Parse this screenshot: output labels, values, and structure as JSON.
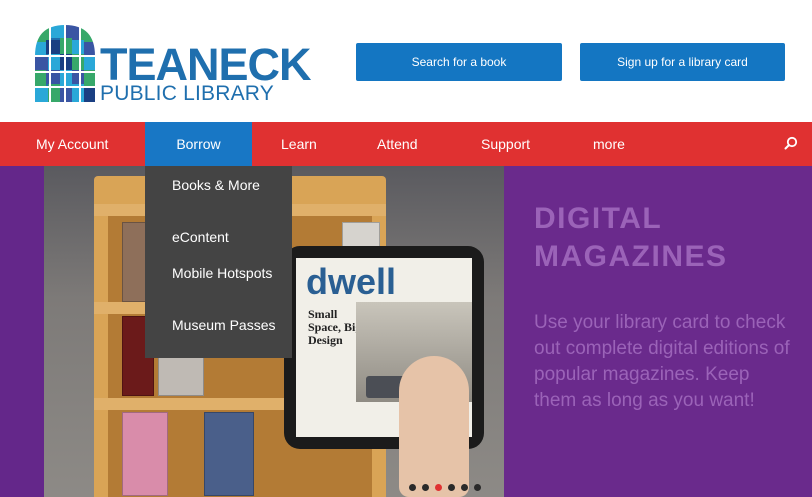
{
  "header": {
    "logo_line1": "TEANECK",
    "logo_line2": "PUBLIC LIBRARY",
    "search_button": "Search for a book",
    "signup_button": "Sign up for a library card"
  },
  "nav": {
    "items": [
      {
        "label": "My Account"
      },
      {
        "label": "Borrow"
      },
      {
        "label": "Learn"
      },
      {
        "label": "Attend"
      },
      {
        "label": "Support"
      },
      {
        "label": "more"
      }
    ],
    "active": "Borrow",
    "search_icon": "search-icon"
  },
  "dropdown": {
    "items": [
      {
        "label": "Books & More"
      },
      {
        "label": "eContent"
      },
      {
        "label": "Mobile Hotspots"
      },
      {
        "label": "Museum Passes"
      }
    ]
  },
  "hero": {
    "heading": "DIGITAL MAGAZINES",
    "body": "Use your library card to check out complete digital editions of popular magazines. Keep them as long as you want!",
    "magazine_title": "dwell",
    "magazine_subtitle": "Small Space, Big Design",
    "carousel_active_index": 2,
    "carousel_count": 6
  },
  "colors": {
    "brand_blue": "#1476c2",
    "nav_red": "#e03131",
    "hero_purple": "#6a2a8c",
    "hero_text": "#9b63b8",
    "dropdown_bg": "#444444"
  }
}
